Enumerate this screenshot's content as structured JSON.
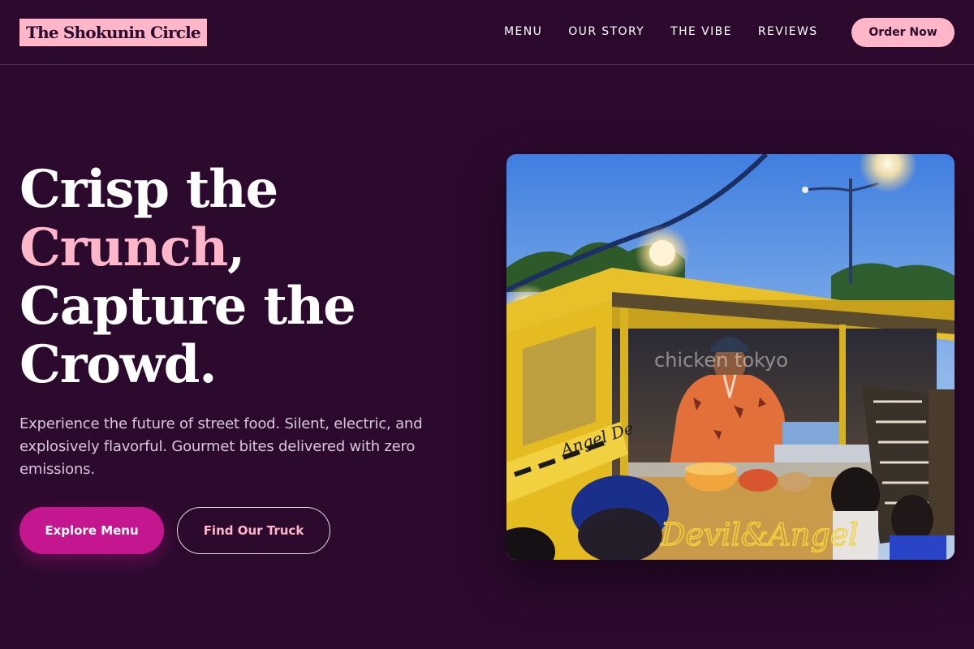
{
  "header": {
    "logo": "The Shokunin Circle",
    "nav": [
      {
        "label": "MENU"
      },
      {
        "label": "OUR STORY"
      },
      {
        "label": "THE VIBE"
      },
      {
        "label": "REVIEWS"
      }
    ],
    "cta": "Order Now"
  },
  "hero": {
    "headline": {
      "line1": "Crisp the",
      "accent": "Crunch",
      "comma": ",",
      "line3": "Capture the",
      "line4": "Crowd."
    },
    "description": "Experience the future of street food. Silent, electric, and explosively flavorful. Gourmet bites delivered with zero emissions.",
    "primary_button": "Explore Menu",
    "secondary_button": "Find Our Truck"
  },
  "photo": {
    "subject": "Chef cooking inside a yellow food truck at a night market",
    "watermark": "chicken tokyo",
    "truck_lettering": "Devil&Angel",
    "stand_lettering": "Angel De"
  },
  "colors": {
    "background": "#2c0a2e",
    "accent_pink": "#ffb6c8",
    "primary_magenta": "#c4168f",
    "body_text": "#d8c7dc",
    "truck_yellow": "#e8c02a"
  }
}
